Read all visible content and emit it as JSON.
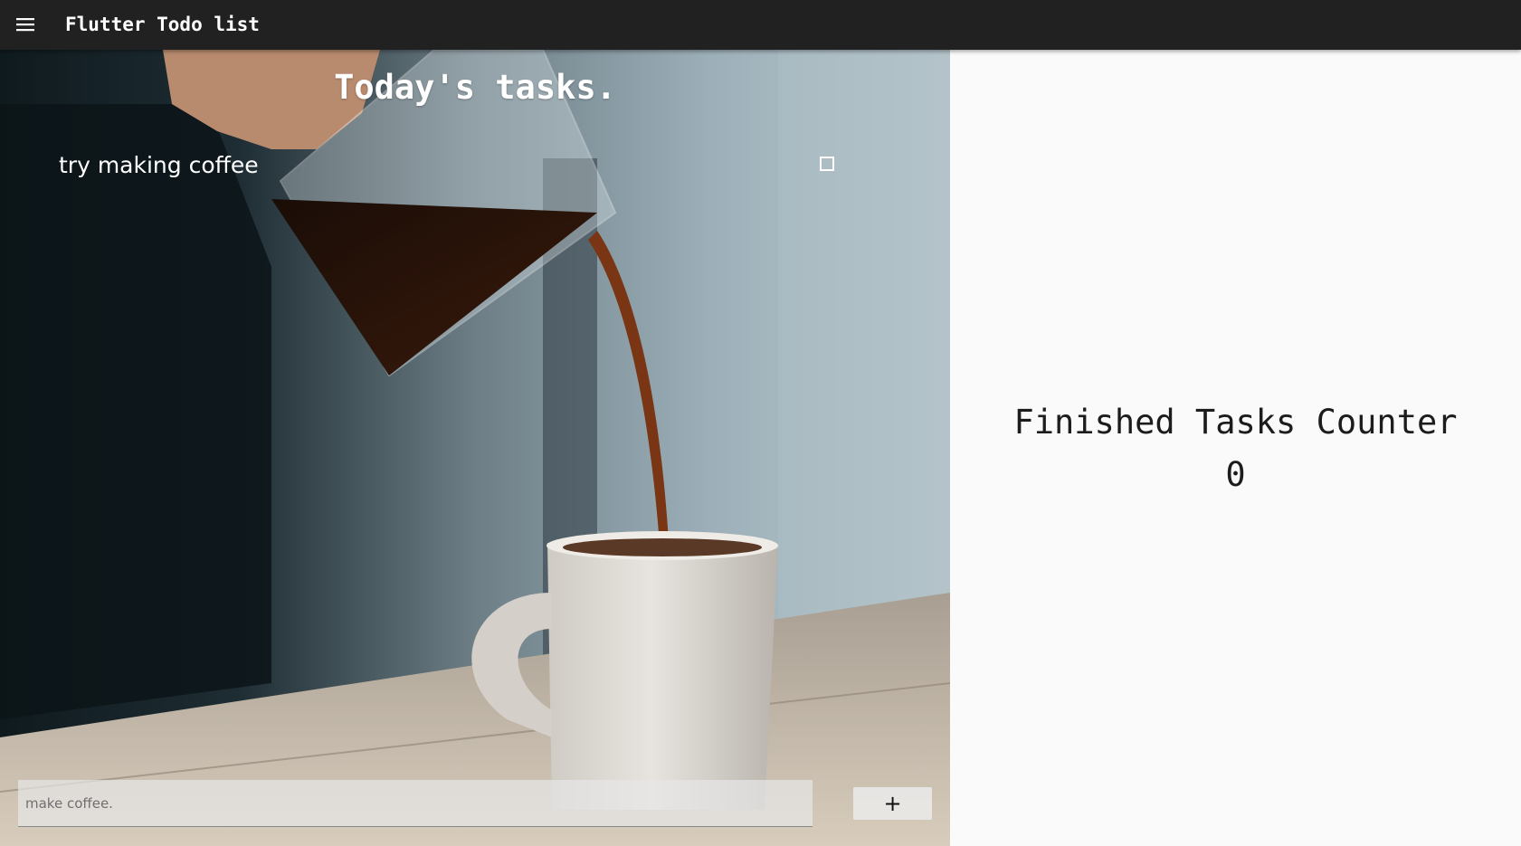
{
  "appbar": {
    "title": "Flutter Todo list",
    "menu_icon": "hamburger-menu-icon",
    "background": "#212121"
  },
  "tasks_panel": {
    "title": "Today's tasks.",
    "background_image": "coffee-pour-photo",
    "tasks": [
      {
        "label": "try making coffee",
        "done": false
      }
    ],
    "new_task_input": {
      "value": "",
      "placeholder": "make coffee."
    },
    "add_button": {
      "label": "+",
      "icon": "plus-icon"
    }
  },
  "counter_panel": {
    "title": "Finished Tasks Counter",
    "value": "0"
  }
}
